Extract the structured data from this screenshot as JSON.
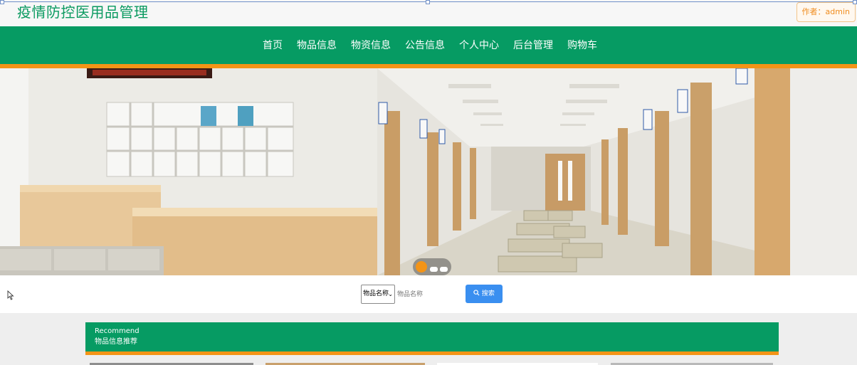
{
  "header": {
    "site_title": "疫情防控医用品管理",
    "author_label": "作者：admin"
  },
  "nav": {
    "items": [
      "首页",
      "物品信息",
      "物资信息",
      "公告信息",
      "个人中心",
      "后台管理",
      "购物车"
    ]
  },
  "search": {
    "field_selected": "物品名称",
    "placeholder": "物品名称",
    "button_label": "搜索"
  },
  "recommend": {
    "title_en": "Recommend",
    "title_zh": "物品信息推荐"
  },
  "carousel": {
    "slide_count": 3,
    "active_index": 0
  },
  "colors": {
    "brand_green": "#069b63",
    "accent_orange": "#f39417",
    "search_blue": "#3a8ff0"
  }
}
